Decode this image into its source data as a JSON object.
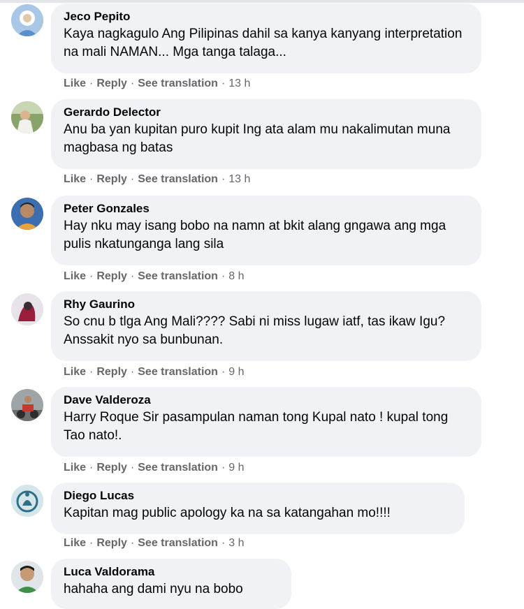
{
  "comments": [
    {
      "author": "Jeco Pepito",
      "text": "Kaya nagkagulo Ang Pilipinas dahil sa kanya kanyang interpretation na mali NAMAN... Mga tanga talaga...",
      "like": "Like",
      "reply": "Reply",
      "see_translation": "See translation",
      "sep": "·",
      "time": "13 h"
    },
    {
      "author": "Gerardo Delector",
      "text": "Anu ba yan kupitan puro kupit Ing ata alam mu nakalimutan muna magbasa ng batas",
      "like": "Like",
      "reply": "Reply",
      "see_translation": "See translation",
      "sep": "·",
      "time": "13 h"
    },
    {
      "author": "Peter Gonzales",
      "text": "Hay nku may isang bobo na namn at bkit alang gngawa ang mga pulis nkatunganga lang sila",
      "like": "Like",
      "reply": "Reply",
      "see_translation": "See translation",
      "sep": "·",
      "time": "8 h"
    },
    {
      "author": "Rhy Gaurino",
      "text": "So cnu b tlga Ang Mali???? Sabi ni miss lugaw iatf, tas ikaw Igu? Anssakit nyo sa bunbunan.",
      "like": "Like",
      "reply": "Reply",
      "see_translation": "See translation",
      "sep": "·",
      "time": "9 h"
    },
    {
      "author": "Dave Valderoza",
      "text": "Harry Roque Sir pasampulan naman tong Kupal nato ! kupal tong Tao nato!.",
      "like": "Like",
      "reply": "Reply",
      "see_translation": "See translation",
      "sep": "·",
      "time": "9 h"
    },
    {
      "author": "Diego Lucas",
      "text": "Kapitan mag public apology ka na sa katangahan mo!!!!",
      "like": "Like",
      "reply": "Reply",
      "see_translation": "See translation",
      "sep": "·",
      "time": "3 h"
    },
    {
      "author": "Luca Valdorama",
      "text": "hahaha ang dami nyu na bobo"
    }
  ]
}
